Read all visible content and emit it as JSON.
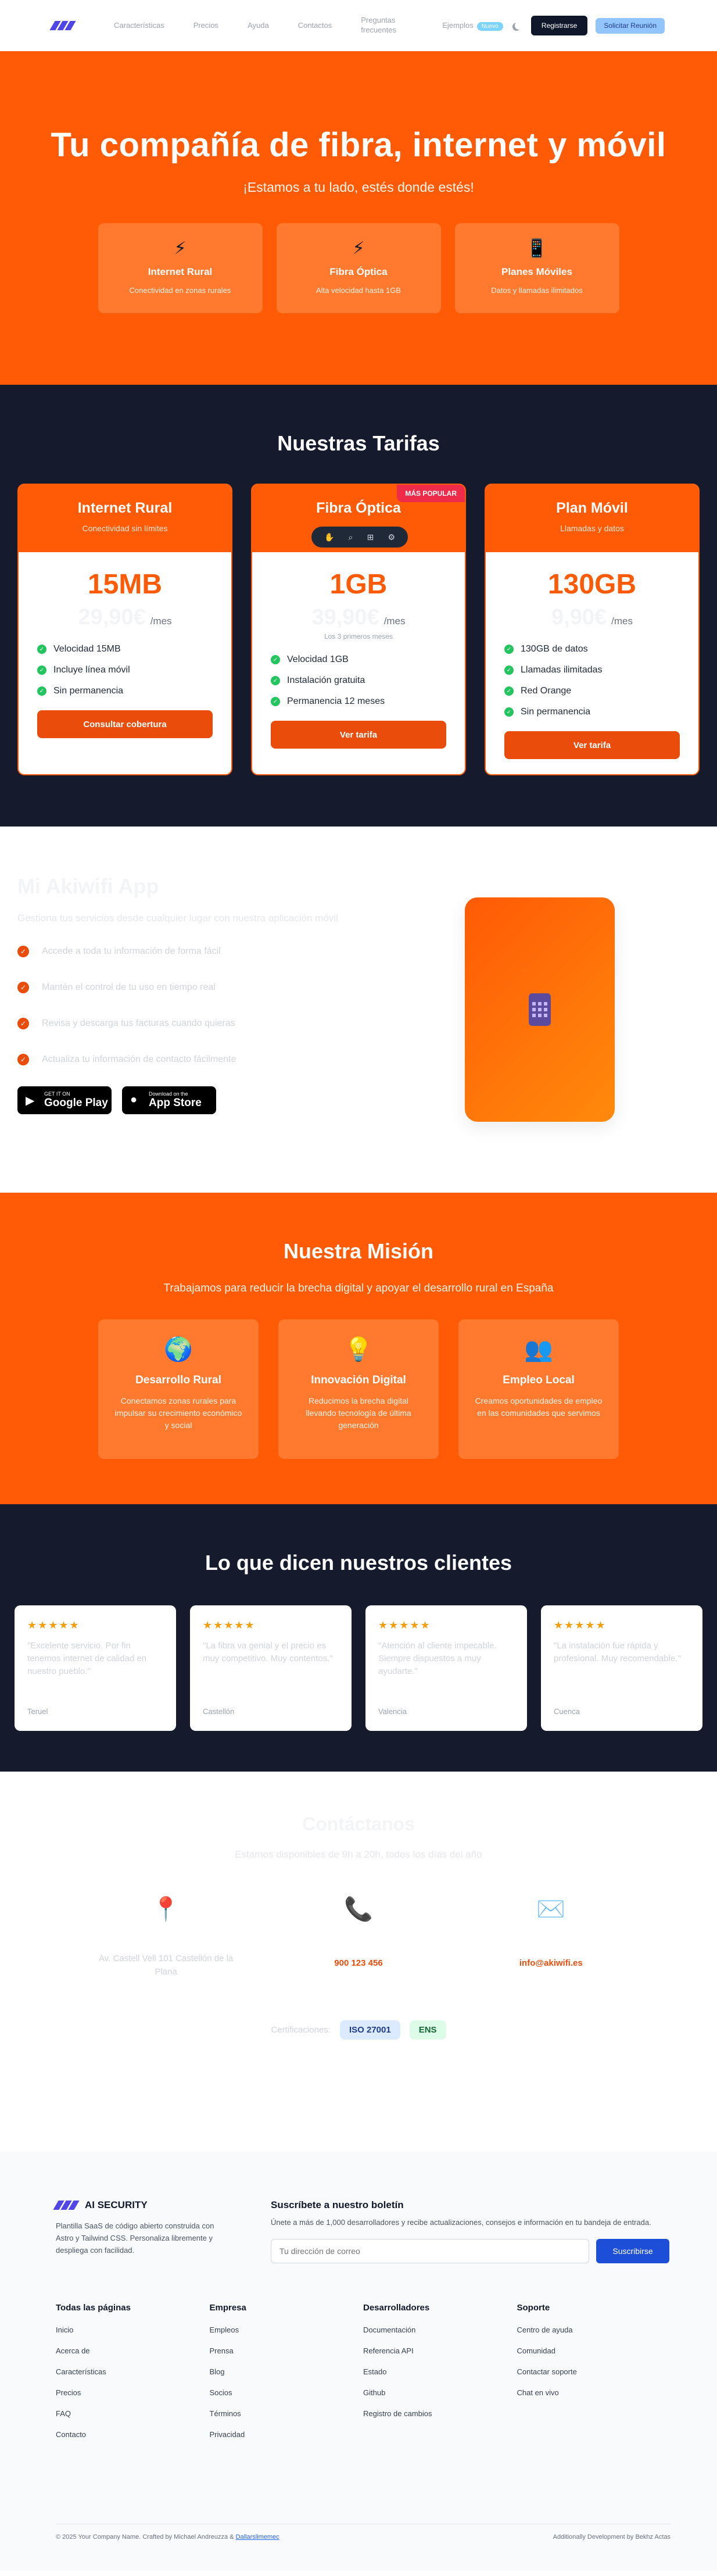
{
  "nav": {
    "links": [
      "Características",
      "Precios",
      "Ayuda",
      "Contactos",
      "Preguntas frecuentes",
      "Ejemplos"
    ],
    "badge": "Nuevo",
    "register_label": "Registrarse",
    "meeting_label": "Solicitar Reunión"
  },
  "hero": {
    "title": "Tu compañía de fibra, internet y móvil",
    "subtitle": "¡Estamos a tu lado, estés donde estés!",
    "cards": [
      {
        "icon": "lightning-icon",
        "title": "Internet Rural",
        "desc": "Conectividad en zonas rurales"
      },
      {
        "icon": "lightning-icon",
        "title": "Fibra Óptica",
        "desc": "Alta velocidad hasta 1GB"
      },
      {
        "icon": "phone-icon",
        "title": "Planes Móviles",
        "desc": "Datos y llamadas ilimitados"
      }
    ]
  },
  "pricing": {
    "title": "Nuestras Tarifas",
    "badge": "MÁS POPULAR",
    "plans": [
      {
        "name": "Internet Rural",
        "tag": "Conectividad sin límites",
        "speed": "15MB",
        "price": "29,90€",
        "period": "/mes",
        "note": "",
        "features": [
          "Velocidad 15MB",
          "Incluye línea móvil",
          "Sin permanencia"
        ],
        "cta": "Consultar cobertura"
      },
      {
        "name": "Fibra Óptica",
        "tag": "",
        "speed": "1GB",
        "price": "39,90€",
        "period": "/mes",
        "note": "Los 3 primeros meses",
        "features": [
          "Velocidad 1GB",
          "Instalación gratuita",
          "Permanencia 12 meses"
        ],
        "cta": "Ver tarifa"
      },
      {
        "name": "Plan Móvil",
        "tag": "Llamadas y datos",
        "speed": "130GB",
        "price": "9,90€",
        "period": "/mes",
        "note": "",
        "features": [
          "130GB de datos",
          "Llamadas ilimitadas",
          "Red Orange",
          "Sin permanencia"
        ],
        "cta": "Ver tarifa"
      }
    ]
  },
  "app": {
    "title": "Mi Akiwifi App",
    "desc": "Gestiona tus servicios desde cualquier lugar con nuestra aplicación móvil",
    "features": [
      "Accede a toda tu información de forma fácil",
      "Mantén el control de tu uso en tiempo real",
      "Revisa y descarga tus facturas cuando quieras",
      "Actualiza tu información de contacto fácilmente"
    ],
    "google": {
      "line1": "GET IT ON",
      "line2": "Google Play"
    },
    "apple": {
      "line1": "Download on the",
      "line2": "App Store"
    }
  },
  "mission": {
    "title": "Nuestra Misión",
    "subtitle": "Trabajamos para reducir la brecha digital y apoyar el desarrollo rural en España",
    "cards": [
      {
        "icon": "globe-icon",
        "glyph": "🌍",
        "title": "Desarrollo Rural",
        "desc": "Conectamos zonas rurales para impulsar su crecimiento económico y social"
      },
      {
        "icon": "lightbulb-icon",
        "glyph": "💡",
        "title": "Innovación Digital",
        "desc": "Reducimos la brecha digital llevando tecnología de última generación"
      },
      {
        "icon": "people-icon",
        "glyph": "👥",
        "title": "Empleo Local",
        "desc": "Creamos oportunidades de empleo en las comunidades que servimos"
      }
    ]
  },
  "testimonials": {
    "title": "Lo que dicen nuestros clientes",
    "stars": "★★★★★",
    "items": [
      {
        "quote": "\"Excelente servicio. Por fin tenemos internet de calidad en nuestro pueblo.\"",
        "author": "Teruel"
      },
      {
        "quote": "\"La fibra va genial y el precio es muy competitivo. Muy contentos.\"",
        "author": "Castellón"
      },
      {
        "quote": "\"Atención al cliente impecable. Siempre dispuestos a muy ayudarte.\"",
        "author": "Valencia"
      },
      {
        "quote": "\"La instalación fue rápida y profesional. Muy recomendable.\"",
        "author": "Cuenca"
      }
    ]
  },
  "contact": {
    "title": "Contáctanos",
    "subtitle": "Estamos disponibles de 9h a 20h, todos los días del año",
    "address": "Av. Castell Vell 101 Castellón de la Plana",
    "phone": "900 123 456",
    "email": "info@akiwifi.es",
    "certs_label": "Certificaciones:",
    "certs": [
      "ISO 27001",
      "ENS"
    ]
  },
  "footer": {
    "brand": "AI SECURITY",
    "brand_desc": "Plantilla SaaS de código abierto construida con Astro y Tailwind CSS. Personaliza libremente y despliega con facilidad.",
    "news_title": "Suscríbete a nuestro boletín",
    "news_desc": "Únete a más de 1,000 desarrolladores y recibe actualizaciones, consejos e información en tu bandeja de entrada.",
    "email_placeholder": "Tu dirección de correo",
    "subscribe_label": "Suscribirse",
    "columns": [
      {
        "title": "Todas las páginas",
        "links": [
          "Inicio",
          "Acerca de",
          "Características",
          "Precios",
          "FAQ",
          "Contacto"
        ]
      },
      {
        "title": "Empresa",
        "links": [
          "Empleos",
          "Prensa",
          "Blog",
          "Socios",
          "Términos",
          "Privacidad"
        ]
      },
      {
        "title": "Desarrolladores",
        "links": [
          "Documentación",
          "Referencia API",
          "Estado",
          "Github",
          "Registro de cambios"
        ]
      },
      {
        "title": "Soporte",
        "links": [
          "Centro de ayuda",
          "Comunidad",
          "Contactar soporte",
          "Chat en vivo"
        ]
      }
    ],
    "copyright_prefix": "© 2025 Your Company Name. Crafted by Michael Andreuzza & ",
    "copyright_link": "Dallarslimemec",
    "credit": "Additionally Development by Bekhz Actas"
  }
}
